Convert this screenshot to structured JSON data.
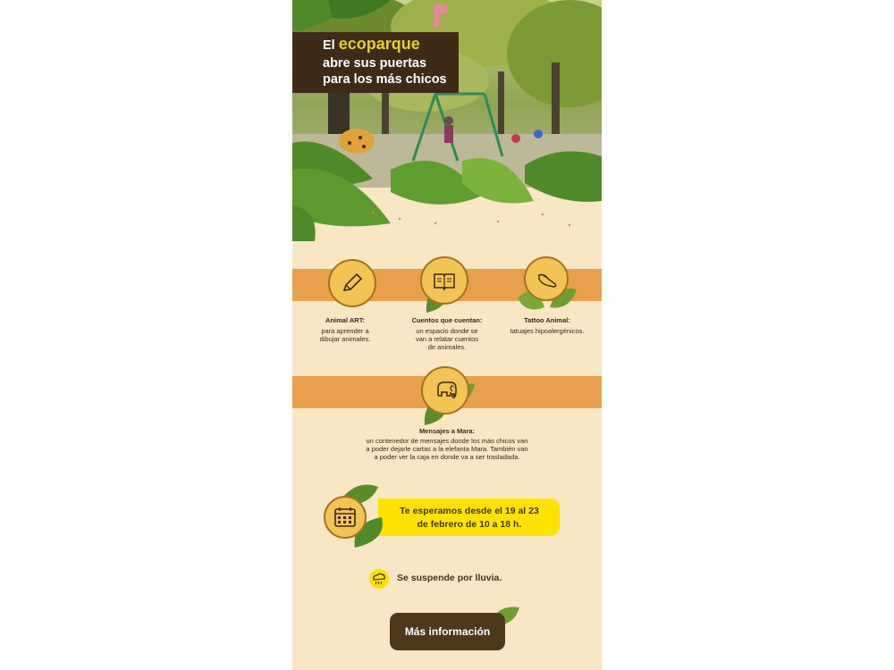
{
  "header": {
    "title_prefix": "El ",
    "title_brand": "ecoparque",
    "title_line2": "abre sus puertas",
    "title_line3": "para los más chicos"
  },
  "activities": [
    {
      "icon": "pencil-icon",
      "title": "Animal ART:",
      "description": [
        "para aprender a",
        "dibujar animales."
      ]
    },
    {
      "icon": "book-icon",
      "title": "Cuentos que cuentan:",
      "description": [
        "un espacio donde se",
        "van a relatar cuentos",
        "de animales."
      ]
    },
    {
      "icon": "hand-tattoo-icon",
      "title": "Tattoo Animal:",
      "description": [
        "tatuajes hipoalergénicos."
      ]
    },
    {
      "icon": "elephant-icon",
      "title": "Mensajes a Mara:",
      "description": [
        "un contenedor de mensajes donde los más chicos van",
        "a poder dejarle cartas a la elefanta Mara. También van",
        "a poder ver la caja en donde va a ser trasladada."
      ]
    }
  ],
  "schedule": {
    "icon": "calendar-icon",
    "line1": "Te esperamos desde el 19 al 23",
    "line2": "de febrero de 10 a 18 h."
  },
  "weather": {
    "icon": "rain-cloud-icon",
    "text": "Se suspende por lluvia."
  },
  "cta": {
    "label": "Más información"
  },
  "colors": {
    "panel": "#f8e6c4",
    "band": "#e8a04c",
    "yellow": "#ffe200",
    "brown": "#4e381a",
    "leaf": "#5c8b2a"
  }
}
